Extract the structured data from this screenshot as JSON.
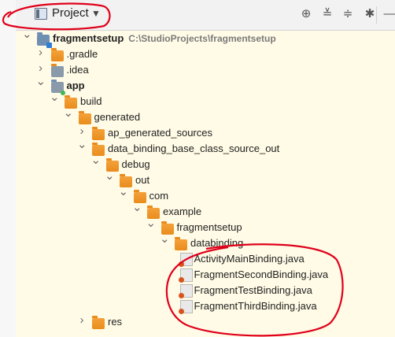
{
  "toolbar": {
    "view_label": "Project",
    "icons": [
      "locate-icon",
      "expand-all-icon",
      "collapse-all-icon",
      "settings-icon",
      "hide-icon"
    ]
  },
  "tree": [
    {
      "label": "fragmentsetup",
      "path": "C:\\StudioProjects\\fragmentsetup",
      "depth": 0,
      "expanded": true,
      "type": "module",
      "bold": true
    },
    {
      "label": ".gradle",
      "depth": 1,
      "expanded": false,
      "type": "folder"
    },
    {
      "label": ".idea",
      "depth": 1,
      "expanded": false,
      "type": "folder-gray"
    },
    {
      "label": "app",
      "depth": 1,
      "expanded": true,
      "type": "app",
      "bold": true
    },
    {
      "label": "build",
      "depth": 2,
      "expanded": true,
      "type": "folder"
    },
    {
      "label": "generated",
      "depth": 3,
      "expanded": true,
      "type": "folder"
    },
    {
      "label": "ap_generated_sources",
      "depth": 4,
      "expanded": false,
      "type": "folder"
    },
    {
      "label": "data_binding_base_class_source_out",
      "depth": 4,
      "expanded": true,
      "type": "folder"
    },
    {
      "label": "debug",
      "depth": 5,
      "expanded": true,
      "type": "folder"
    },
    {
      "label": "out",
      "depth": 6,
      "expanded": true,
      "type": "folder"
    },
    {
      "label": "com",
      "depth": 7,
      "expanded": true,
      "type": "folder"
    },
    {
      "label": "example",
      "depth": 8,
      "expanded": true,
      "type": "folder"
    },
    {
      "label": "fragmentsetup",
      "depth": 9,
      "expanded": true,
      "type": "folder"
    },
    {
      "label": "databinding",
      "depth": 10,
      "expanded": true,
      "type": "folder"
    },
    {
      "label": "ActivityMainBinding.java",
      "depth": 11,
      "type": "java"
    },
    {
      "label": "FragmentSecondBinding.java",
      "depth": 11,
      "type": "java"
    },
    {
      "label": "FragmentTestBinding.java",
      "depth": 11,
      "type": "java"
    },
    {
      "label": "FragmentThirdBinding.java",
      "depth": 11,
      "type": "java"
    },
    {
      "label": "res",
      "depth": 4,
      "expanded": false,
      "type": "folder"
    }
  ],
  "colors": {
    "tree_background": "#fffbe6",
    "folder": "#e98c1c",
    "annotation": "#e0001a"
  }
}
